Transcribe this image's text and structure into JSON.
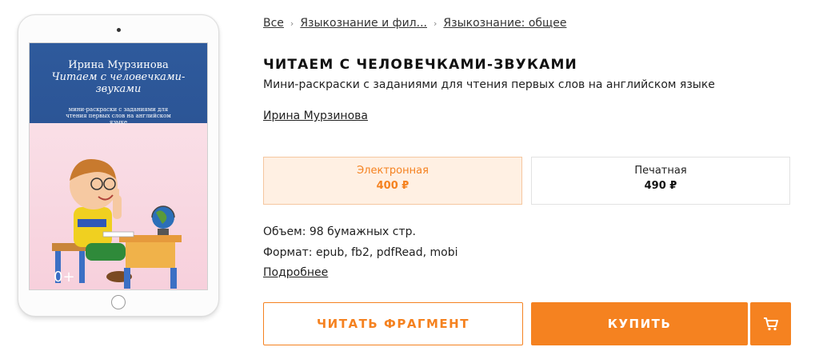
{
  "breadcrumb": [
    {
      "label": "Все"
    },
    {
      "label": "Языкознание и фил..."
    },
    {
      "label": "Языкознание: общее"
    }
  ],
  "breadcrumb_separator": "›",
  "book": {
    "title": "ЧИТАЕМ С ЧЕЛОВЕЧКАМИ-ЗВУКАМИ",
    "subtitle": "Мини-раскраски с заданиями для чтения первых слов на английском языке",
    "author": "Ирина Мурзинова"
  },
  "cover": {
    "author": "Ирина Мурзинова",
    "title": "Читаем с человечками-звуками",
    "subtitle": "мини-раскраски с заданиями для чтения первых слов на английском языке",
    "age_rating": "0+"
  },
  "price_options": [
    {
      "type": "Электронная",
      "price": "400 ₽",
      "selected": true
    },
    {
      "type": "Печатная",
      "price": "490 ₽",
      "selected": false
    }
  ],
  "meta": {
    "volume": "Объем: 98 бумажных стр.",
    "format": "Формат: epub, fb2, pdfRead, mobi",
    "more_link": "Подробнее"
  },
  "actions": {
    "read_fragment": "ЧИТАТЬ ФРАГМЕНТ",
    "buy": "КУПИТЬ",
    "cart_icon": "cart-icon"
  },
  "colors": {
    "accent": "#f58220",
    "accent_light_bg": "#fff0e3",
    "cover_blue": "#2e5a9c",
    "cover_pink": "#f7d0dc"
  }
}
